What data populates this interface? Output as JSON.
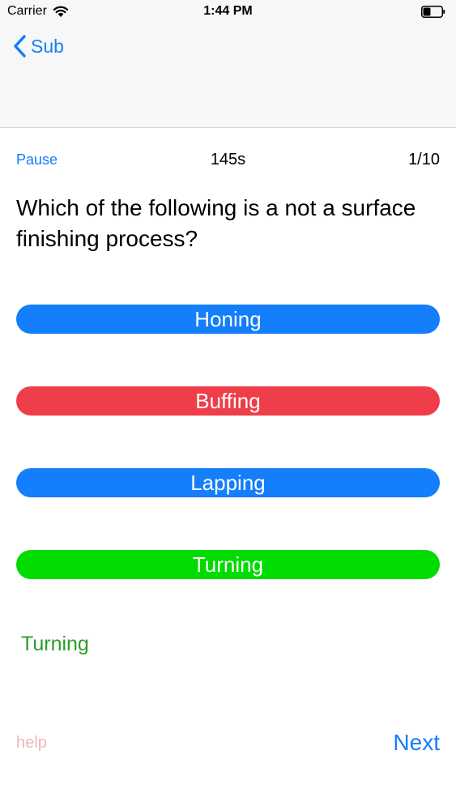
{
  "status_bar": {
    "carrier": "Carrier",
    "time": "1:44 PM",
    "icons": [
      "wifi-icon",
      "battery-icon"
    ],
    "battery_level": 0.4
  },
  "nav": {
    "back_label": "Sub",
    "back_icon": "chevron-left-icon"
  },
  "quiz": {
    "pause_label": "Pause",
    "timer": "145s",
    "progress": "1/10",
    "question": "Which of the following is a not a surface finishing process?",
    "answers": [
      {
        "label": "Honing",
        "color": "#147efb"
      },
      {
        "label": "Buffing",
        "color": "#ef3e4a"
      },
      {
        "label": "Lapping",
        "color": "#147efb"
      },
      {
        "label": "Turning",
        "color": "#00dc00"
      }
    ],
    "result": {
      "text": "Turning",
      "color": "#2e9b2e"
    },
    "help_label": "help",
    "next_label": "Next"
  },
  "colors": {
    "accent": "#147efb",
    "nav_background": "#f7f7f7",
    "help": "#f4b5b8"
  }
}
